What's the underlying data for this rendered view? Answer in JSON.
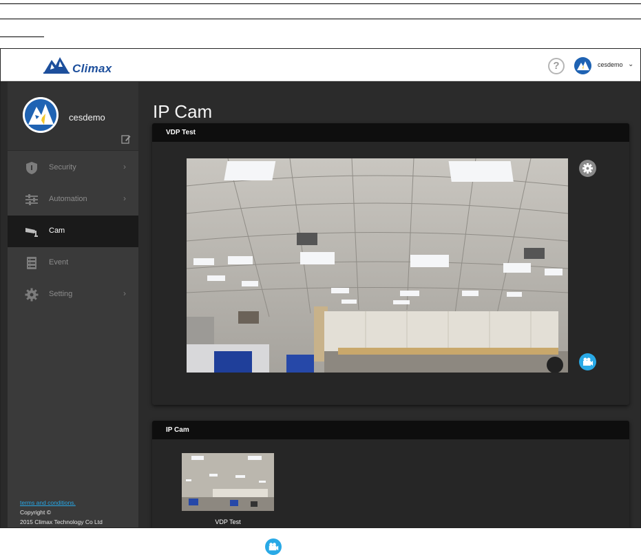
{
  "brand": {
    "name": "Climax"
  },
  "header": {
    "help_symbol": "?",
    "username": "cesdemo",
    "dropdown_glyph": "⌄"
  },
  "sidebar": {
    "profile_name": "cesdemo",
    "items": [
      {
        "label": "Security",
        "icon": "shield-icon",
        "arrow": "›"
      },
      {
        "label": "Automation",
        "icon": "sliders-icon",
        "arrow": "›"
      },
      {
        "label": "Cam",
        "icon": "camera-icon",
        "arrow": ""
      },
      {
        "label": "Event",
        "icon": "list-icon",
        "arrow": ""
      },
      {
        "label": "Setting",
        "icon": "gear-icon",
        "arrow": "›"
      }
    ],
    "active_item": "Cam",
    "footer": {
      "terms_link": "terms and conditions.",
      "copyright": "Copyright ©",
      "company": "2015 Climax Technology Co Ltd"
    }
  },
  "main": {
    "page_title": "IP Cam",
    "live_panel": {
      "title": "VDP Test"
    },
    "list_panel": {
      "title": "IP Cam",
      "cameras": [
        {
          "label": "VDP Test"
        }
      ]
    }
  },
  "colors": {
    "accent_blue": "#29a9e6",
    "brand_blue": "#1d4f9c",
    "sidebar_bg": "#3a3a3a",
    "panel_header": "#0e0e0e"
  }
}
